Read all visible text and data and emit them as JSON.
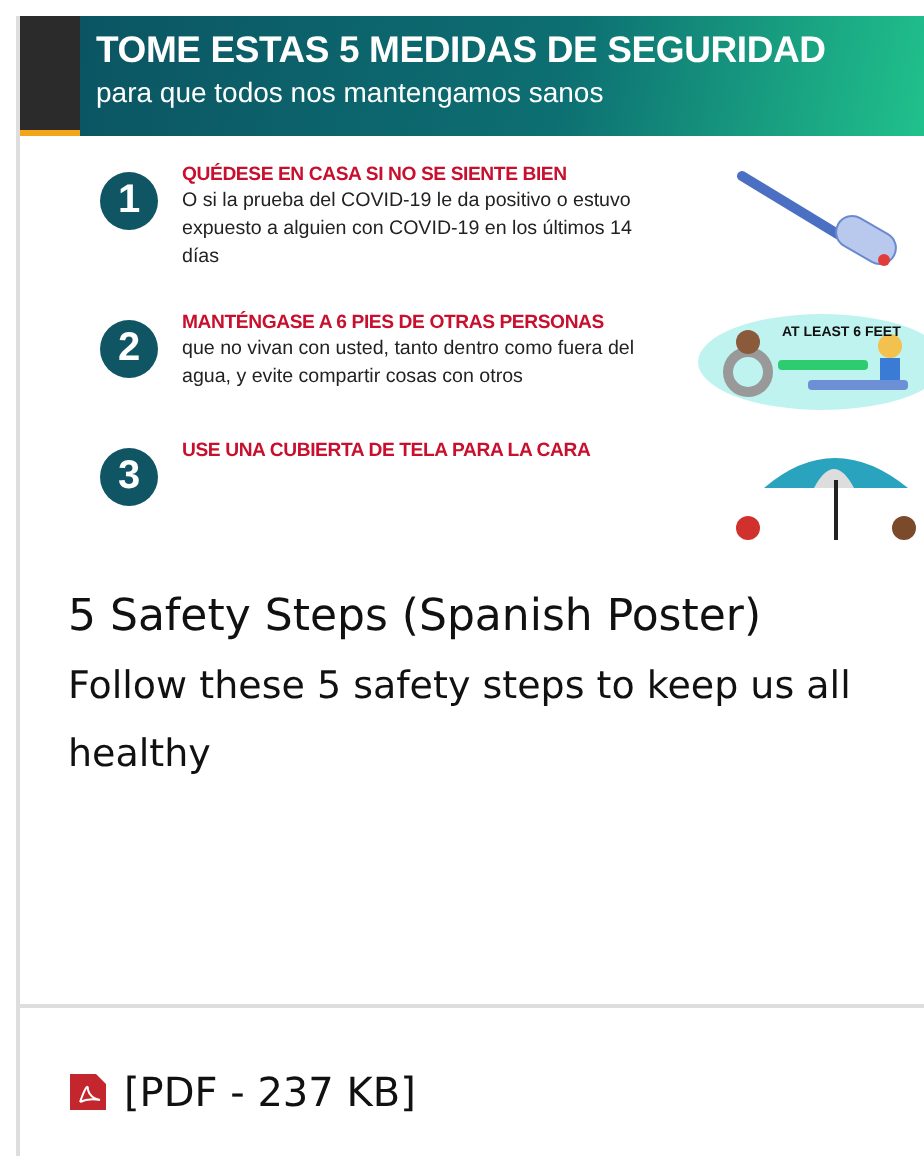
{
  "poster": {
    "title": "TOME ESTAS 5 MEDIDAS DE SEGURIDAD",
    "subtitle": "para que todos nos mantengamos sanos",
    "steps": [
      {
        "number": "1",
        "heading": "QUÉDESE EN CASA SI NO SE SIENTE BIEN",
        "body": "O si la prueba del COVID-19 le da positivo o estuvo expuesto a alguien con COVID-19 en los últimos 14 días",
        "kind": "thermometer"
      },
      {
        "number": "2",
        "heading": "MANTÉNGASE A 6 PIES DE OTRAS PERSONAS",
        "body": "que no vivan con usted, tanto dentro como fuera del agua, y evite compartir cosas con otros",
        "kind": "pool",
        "caption": "AT LEAST 6 FEET"
      },
      {
        "number": "3",
        "heading": "USE UNA CUBIERTA DE TELA PARA LA CARA",
        "kind": "umbrella"
      }
    ]
  },
  "card": {
    "title": "5 Safety Steps (Spanish Poster)",
    "description": "Follow these 5 safety steps to keep us all healthy"
  },
  "download": {
    "label": "[PDF - 237 KB]"
  }
}
